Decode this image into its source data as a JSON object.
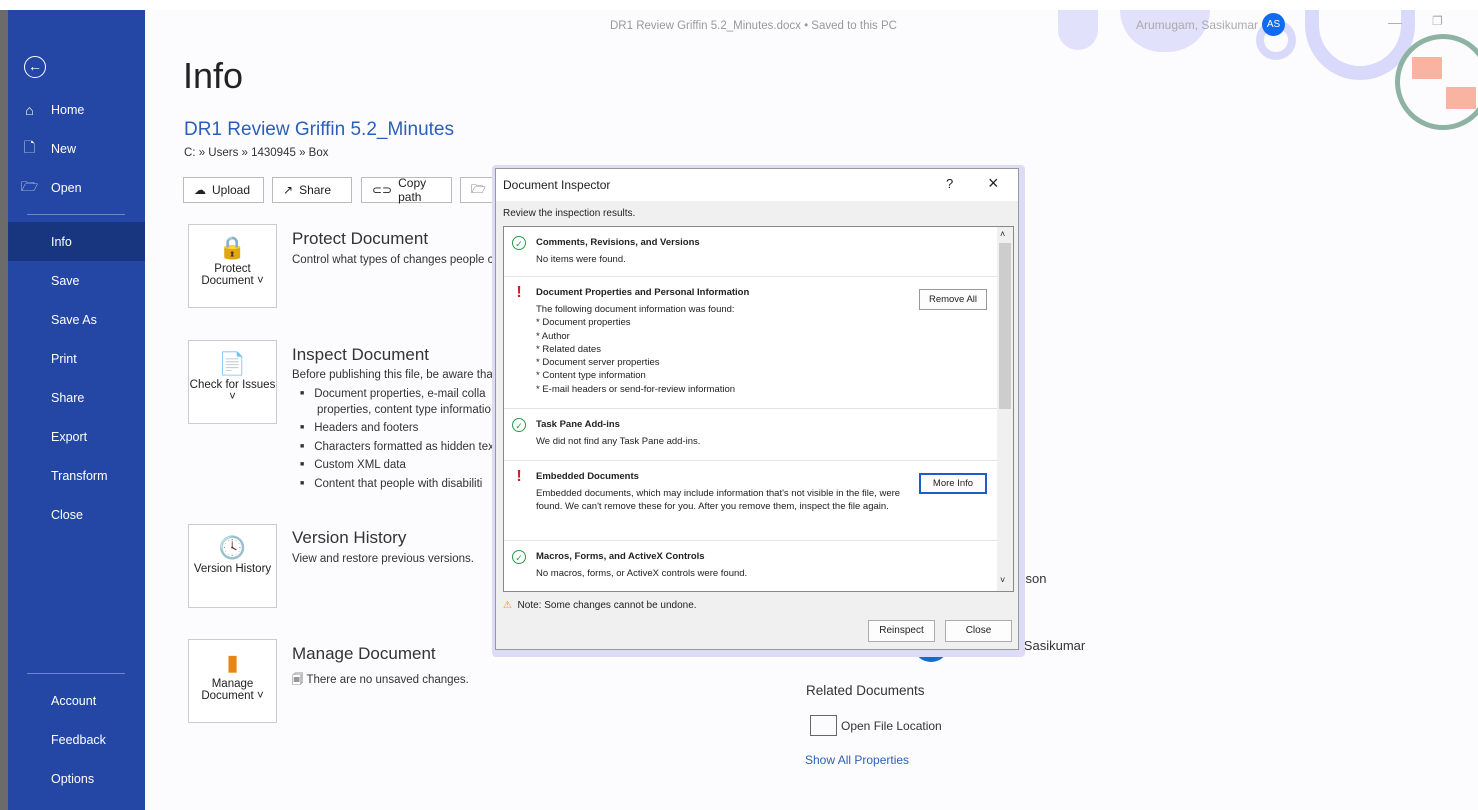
{
  "window": {
    "title": "DR1 Review Griffin 5.2_Minutes.docx • Saved to this PC",
    "user": "Arumugam, Sasikumar",
    "avatar": "AS"
  },
  "sidebar": {
    "items": [
      {
        "label": "Home",
        "icon": "home-icon"
      },
      {
        "label": "New",
        "icon": "new-doc-icon"
      },
      {
        "label": "Open",
        "icon": "folder-open-icon"
      },
      {
        "label": "Info"
      },
      {
        "label": "Save"
      },
      {
        "label": "Save As"
      },
      {
        "label": "Print"
      },
      {
        "label": "Share"
      },
      {
        "label": "Export"
      },
      {
        "label": "Transform"
      },
      {
        "label": "Close"
      }
    ],
    "bottom": [
      {
        "label": "Account"
      },
      {
        "label": "Feedback"
      },
      {
        "label": "Options"
      }
    ],
    "selected": "Info"
  },
  "main": {
    "heading": "Info",
    "doc_name": "DR1 Review Griffin 5.2_Minutes",
    "path": "C: » Users » 1430945 » Box",
    "toolbar": [
      {
        "label": "Upload"
      },
      {
        "label": "Share"
      },
      {
        "label": "Copy path"
      },
      {
        "label": "O"
      }
    ],
    "protect": {
      "card": "Protect Document",
      "title": "Protect Document",
      "desc": "Control what types of changes people c"
    },
    "inspect": {
      "card": "Check for Issues",
      "title": "Inspect Document",
      "desc": "Before publishing this file, be aware tha",
      "bullets": [
        "Document properties, e-mail colla",
        "properties, content type informatio",
        "Headers and footers",
        "Characters formatted as hidden tex",
        "Custom XML data",
        "Content that people with disabiliti"
      ]
    },
    "version": {
      "card": "Version History",
      "title": "Version History",
      "desc": "View and restore previous versions."
    },
    "manage": {
      "card": "Manage Document",
      "title": "Manage Document",
      "desc": "There are no unsaved changes."
    }
  },
  "right": {
    "partial1": "sson",
    "partial2": "Arumugam, Sasikumar",
    "related_title": "Related Documents",
    "open_location": "Open File Location",
    "show_all": "Show All Properties"
  },
  "dialog": {
    "title": "Document Inspector",
    "help": "?",
    "subtitle": "Review the inspection results.",
    "sections": [
      {
        "status": "ok",
        "title": "Comments, Revisions, and Versions",
        "body": "No items were found."
      },
      {
        "status": "warn",
        "title": "Document Properties and Personal Information",
        "body": "The following document information was found:\n* Document properties\n* Author\n* Related dates\n* Document server properties\n* Content type information\n* E-mail headers or send-for-review information",
        "button": "Remove All"
      },
      {
        "status": "ok",
        "title": "Task Pane Add-ins",
        "body": "We did not find any Task Pane add-ins."
      },
      {
        "status": "warn",
        "title": "Embedded Documents",
        "body": "Embedded documents, which may include information that's not visible in the file, were found. We can't remove these for you. After you remove them, inspect the file again.",
        "button": "More Info"
      },
      {
        "status": "ok",
        "title": "Macros, Forms, and ActiveX Controls",
        "body": "No macros, forms, or ActiveX controls were found."
      }
    ],
    "note": "Note: Some changes cannot be undone.",
    "reinspect": "Reinspect",
    "close": "Close"
  },
  "colors": {
    "sidebar": "#2447a6",
    "accent": "#2b5fb8",
    "ok": "#2a9a4a",
    "warn": "#d02020"
  }
}
